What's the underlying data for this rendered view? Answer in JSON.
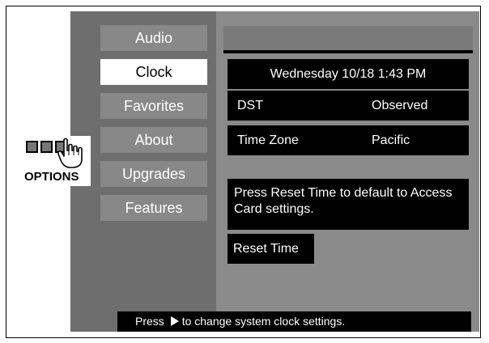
{
  "menu": {
    "items": [
      {
        "label": "Audio",
        "active": false
      },
      {
        "label": "Clock",
        "active": true
      },
      {
        "label": "Favorites",
        "active": false
      },
      {
        "label": "About",
        "active": false
      },
      {
        "label": "Upgrades",
        "active": false
      },
      {
        "label": "Features",
        "active": false
      }
    ]
  },
  "clock": {
    "datetime": "Wednesday 10/18 1:43 PM",
    "dst_label": "DST",
    "dst_value": "Observed",
    "timezone_label": "Time Zone",
    "timezone_value": "Pacific",
    "info_text": "Press Reset Time to default to Access Card settings.",
    "reset_label": "Reset Time"
  },
  "status": {
    "prefix": "Press",
    "arrow_icon": "play-right-icon",
    "suffix": "to change system clock settings."
  },
  "options": {
    "label": "OPTIONS",
    "icon": "hand-pointer-icon"
  },
  "colors": {
    "left_panel": "#6e6e6e",
    "right_panel": "#8a8a8a",
    "menu_item": "#888888",
    "active_item": "#ffffff",
    "box": "#000000"
  }
}
